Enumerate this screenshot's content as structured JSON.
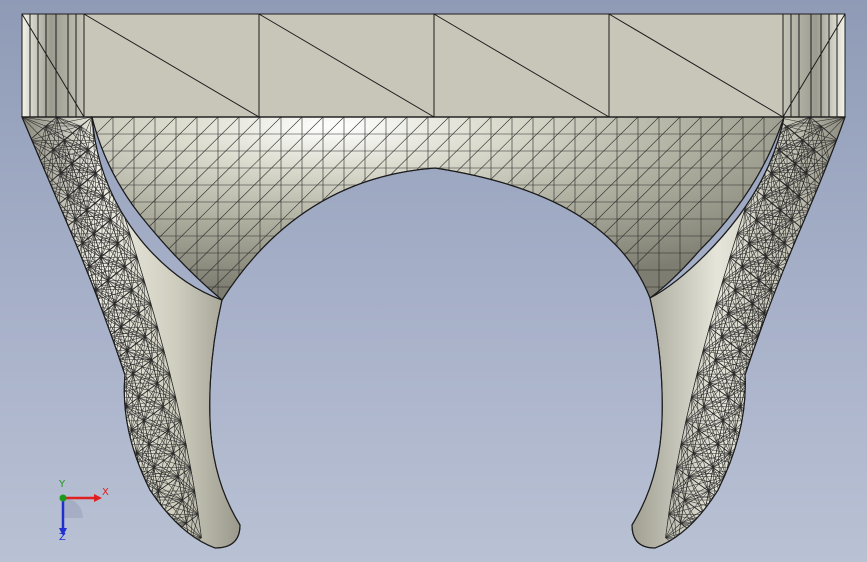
{
  "viewport": {
    "background_top": "#8f9bb6",
    "background_bottom": "#b9c1d4"
  },
  "model": {
    "display_style": "shaded with mesh edges",
    "part_color": "#d8d7c8",
    "edge_color": "#1c1c1c"
  },
  "triad": {
    "x_label": "X",
    "y_label": "Y",
    "z_label": "Z",
    "x_color": "#e02020",
    "y_color": "#1a9a1a",
    "z_color": "#2030d0"
  }
}
